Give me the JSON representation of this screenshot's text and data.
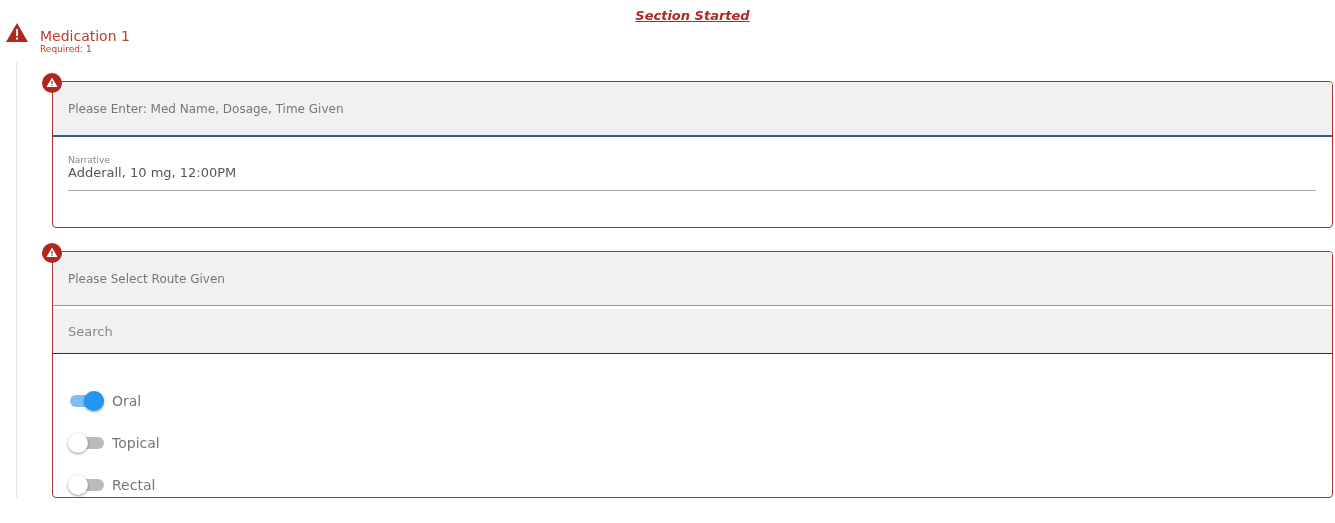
{
  "status_link": "Section Started",
  "section": {
    "title": "Medication 1",
    "required": "Required: 1"
  },
  "questions": [
    {
      "kind": "text",
      "prompt": "Please Enter: Med Name, Dosage, Time Given",
      "field": {
        "label": "Narrative",
        "value": "Adderall, 10 mg, 12:00PM"
      }
    },
    {
      "kind": "choice",
      "prompt": "Please Select Route Given",
      "search": {
        "placeholder": "Search"
      },
      "options": [
        {
          "label": "Oral",
          "on": true
        },
        {
          "label": "Topical",
          "on": false
        },
        {
          "label": "Rectal",
          "on": false
        }
      ]
    }
  ]
}
